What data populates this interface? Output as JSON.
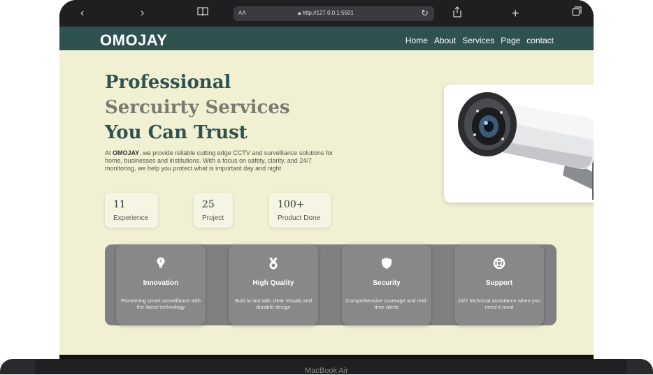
{
  "browser": {
    "text_size_label": "AA",
    "url": "http://127.0.0.1:5501",
    "icons": [
      "chevron-left-icon",
      "chevron-right-icon",
      "book-icon",
      "lock-icon",
      "reload-icon",
      "share-icon",
      "plus-icon",
      "tabs-icon"
    ]
  },
  "site": {
    "logo": "OMOJAY",
    "nav": [
      "Home",
      "About",
      "Services",
      "Page",
      "contact"
    ],
    "hero": {
      "title_line1": "Professional",
      "title_line2": "Sercuirty Services",
      "title_line3": "You Can Trust",
      "desc_brand": "OMOJAY",
      "desc_prefix": "At ",
      "desc_rest": ", we provide reliable cutting edge CCTV and survelliance solutions for home, businesses and institutions. With a focus on safety, clarity, and 24/7 monitoring, we help you protect what is important day and night"
    },
    "stats": [
      {
        "value": "11",
        "label": "Experience"
      },
      {
        "value": "25",
        "label": "Project"
      },
      {
        "value": "100+",
        "label": "Product Done"
      }
    ],
    "features": [
      {
        "icon": "lightbulb-icon",
        "title": "Innovation",
        "desc": "Pioneering smart surveillance with the latest technology"
      },
      {
        "icon": "medal-icon",
        "title": "High Quality",
        "desc": "Built to last with clear visuals and durable design"
      },
      {
        "icon": "shield-icon",
        "title": "Security",
        "desc": "Comprehensive coverage and real-time alerts"
      },
      {
        "icon": "lifebuoy-icon",
        "title": "Support",
        "desc": "24/7 technical assistance when you need it most"
      }
    ]
  },
  "device": {
    "label": "MacBook Air"
  },
  "colors": {
    "nav": "#2e5250",
    "page_bg": "#f1f0d2",
    "feature_band": "#808080",
    "feature_card": "#888888"
  }
}
